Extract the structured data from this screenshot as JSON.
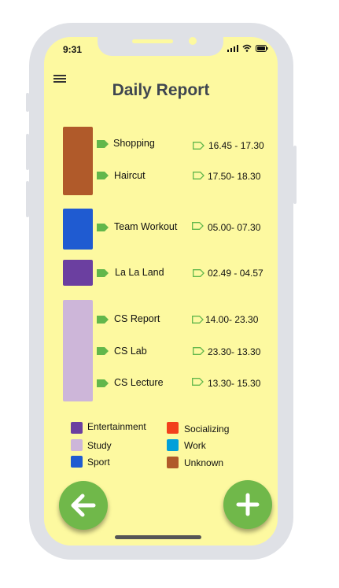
{
  "status_bar": {
    "time": "9:31"
  },
  "header": {
    "title": "Daily Report"
  },
  "colors": {
    "Entertainment": "#6b3fa0",
    "Study": "#cdb6d9",
    "Sport": "#1f5bd1",
    "Socializing": "#f2401c",
    "Work": "#00a0d9",
    "Unknown": "#b05a2a",
    "tag": "#62b74b",
    "fab": "#70b84a"
  },
  "activities": [
    {
      "label": "Shopping",
      "time": "16.45 - 17.30",
      "category": "Unknown"
    },
    {
      "label": "Haircut",
      "time": "17.50- 18.30",
      "category": "Unknown"
    },
    {
      "label": "Team Workout",
      "time": "05.00- 07.30",
      "category": "Sport"
    },
    {
      "label": "La La Land",
      "time": "02.49 - 04.57",
      "category": "Entertainment"
    },
    {
      "label": "CS Report",
      "time": "14.00- 23.30",
      "category": "Study"
    },
    {
      "label": "CS Lab",
      "time": "23.30- 13.30",
      "category": "Study"
    },
    {
      "label": "CS Lecture",
      "time": "13.30- 15.30",
      "category": "Study"
    }
  ],
  "legend": [
    {
      "label": "Entertainment",
      "color": "#6b3fa0"
    },
    {
      "label": "Study",
      "color": "#cdb6d9"
    },
    {
      "label": "Sport",
      "color": "#1f5bd1"
    },
    {
      "label": "Socializing",
      "color": "#f2401c"
    },
    {
      "label": "Work",
      "color": "#00a0d9"
    },
    {
      "label": "Unknown",
      "color": "#b05a2a"
    }
  ],
  "icons": {
    "menu": "hamburger-menu-icon",
    "back": "arrow-left-icon",
    "add": "plus-icon",
    "tag_filled": "tag-icon",
    "tag_outline": "tag-outline-icon"
  }
}
